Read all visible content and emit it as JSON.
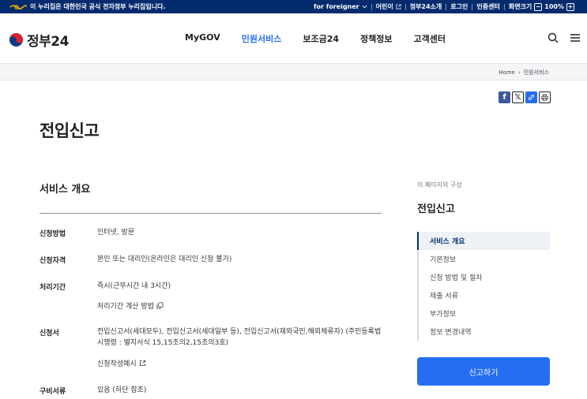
{
  "topbar": {
    "gov_notice": "이 누리집은 대한민국 공식 전자정부 누리집입니다.",
    "foreigner": "for foreigner",
    "kids": "어린이",
    "about": "정부24소개",
    "login": "로그인",
    "cert": "인증센터",
    "zoom_label": "화면크기",
    "zoom_minus": "−",
    "zoom_value": "100%",
    "zoom_plus": "+"
  },
  "header": {
    "logo_text": "정부24",
    "menus": [
      "MyGOV",
      "민원서비스",
      "보조금24",
      "정책정보",
      "고객센터"
    ],
    "active_menu": "민원서비스"
  },
  "breadcrumb": {
    "home": "Home",
    "current": "민원서비스"
  },
  "page": {
    "title": "전입신고",
    "section_title": "서비스 개요"
  },
  "rows": [
    {
      "label": "신청방법",
      "value": "인터넷, 방문"
    },
    {
      "label": "신청자격",
      "value": "본인 또는 대리인(온라인은 대리인 신청 불가)"
    },
    {
      "label": "처리기간",
      "value": "즉시(근무시간 내 3시간)",
      "link": "처리기간 계산 방법"
    },
    {
      "label": "신청서",
      "value_line1": "전입신고서(세대모두), 전입신고서(세대일부 등), 전입신고서(재외국민,해외체류자) (주민등록법",
      "value_line2": "시행령 : 별지서식 15,15조의2,15조의3호)",
      "link": "신청작성예시"
    },
    {
      "label": "구비서류",
      "value": "있음 (하단 참조)"
    }
  ],
  "toc": {
    "caption": "이 페이지의 구성",
    "title": "전입신고",
    "items": [
      "서비스 개요",
      "기본정보",
      "신청 방법 및 절차",
      "제출 서류",
      "부가정보",
      "정보 변경내역"
    ],
    "active": "서비스 개요"
  },
  "apply_button": "신고하기",
  "colors": {
    "navy": "#052b6f",
    "primary": "#256ef4"
  }
}
